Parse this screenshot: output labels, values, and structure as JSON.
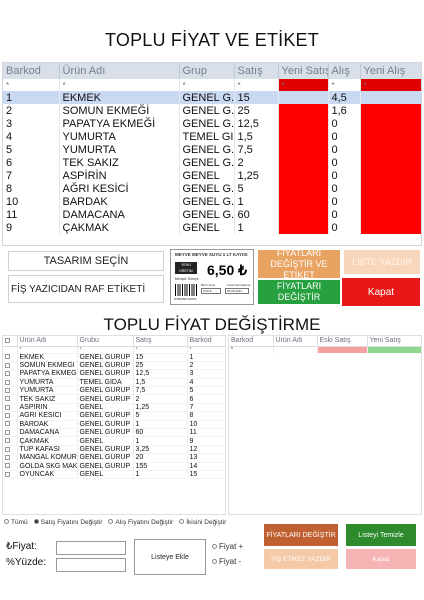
{
  "panel1": {
    "title": "TOPLU FİYAT VE ETİKET",
    "columns": [
      "Barkod",
      "Ürün Adı",
      "Grup",
      "Satış",
      "Yeni Satış",
      "Alış",
      "Yeni Alış"
    ],
    "star": "*",
    "rows": [
      {
        "barkod": "1",
        "urun": "EKMEK",
        "grup": "GENEL G...",
        "satis": "15",
        "alis": "4,5"
      },
      {
        "barkod": "2",
        "urun": "SOMUN EKMEĞİ",
        "grup": "GENEL G...",
        "satis": "25",
        "alis": "1,6"
      },
      {
        "barkod": "3",
        "urun": "PAPATYA EKMEĞİ",
        "grup": "GENEL G...",
        "satis": "12,5",
        "alis": "0"
      },
      {
        "barkod": "4",
        "urun": "YUMURTA",
        "grup": "TEMEL GI...",
        "satis": "1,5",
        "alis": "0"
      },
      {
        "barkod": "5",
        "urun": "YUMURTA",
        "grup": "GENEL G...",
        "satis": "7,5",
        "alis": "0"
      },
      {
        "barkod": "6",
        "urun": "TEK SAKIZ",
        "grup": "GENEL G...",
        "satis": "2",
        "alis": "0"
      },
      {
        "barkod": "7",
        "urun": "ASPİRİN",
        "grup": "GENEL",
        "satis": "1,25",
        "alis": "0"
      },
      {
        "barkod": "8",
        "urun": "AĞRI KESİCİ",
        "grup": "GENEL G...",
        "satis": "5",
        "alis": "0"
      },
      {
        "barkod": "10",
        "urun": "BARDAK",
        "grup": "GENEL G...",
        "satis": "1",
        "alis": "0"
      },
      {
        "barkod": "11",
        "urun": "DAMACANA",
        "grup": "GENEL G...",
        "satis": "60",
        "alis": "0"
      },
      {
        "barkod": "9",
        "urun": "ÇAKMAK",
        "grup": "GENEL",
        "satis": "1",
        "alis": "0"
      }
    ],
    "design_select": "TASARIM SEÇİN",
    "receipt_label": "FİŞ YAZICIDAN RAF ETİKETİ",
    "label_preview": {
      "title": "MEYVE MEYVE SUYU 1 LT KAYISI",
      "logo": "YERLİ ÜRETİM",
      "price": "6,50 ₺",
      "origin": "Menşei:Türkiye",
      "barcode": "8*999999*23655",
      "unit_caption": "Birim Fiyat",
      "unit_value": "6,50 ₺",
      "date_caption": "Fiyat Güncelleme",
      "date_value": "26.08.2021"
    },
    "buttons": {
      "change_label": "FİYATLARI DEĞİŞTİR VE ETİKET",
      "list_print": "LİSTE YAZDIR",
      "change_price": "FİYATLARI DEĞİŞTİR",
      "close": "Kapat"
    },
    "colors": {
      "accent_red": "#ff0000",
      "orange": "#e8a262",
      "green": "#27a040"
    }
  },
  "panel2": {
    "title": "TOPLU FİYAT DEĞİŞTİRME",
    "left_columns": [
      "",
      "Ürün Adı",
      "Grubu",
      "Satış",
      "Barkod"
    ],
    "star": "*",
    "left_rows": [
      {
        "urun": "EKMEK",
        "grup": "GENEL GURUP",
        "satis": "15",
        "barkod": "1"
      },
      {
        "urun": "SOMUN EKMEĞİ",
        "grup": "GENEL GURUP",
        "satis": "25",
        "barkod": "2"
      },
      {
        "urun": "PAPATYA EKMEĞİ",
        "grup": "GENEL GURUP",
        "satis": "12,5",
        "barkod": "3"
      },
      {
        "urun": "YUMURTA",
        "grup": "TEMEL GIDA",
        "satis": "1,5",
        "barkod": "4"
      },
      {
        "urun": "YUMURTA",
        "grup": "GENEL GURUP",
        "satis": "7,5",
        "barkod": "5"
      },
      {
        "urun": "TEK SAKIZ",
        "grup": "GENEL GURUP",
        "satis": "2",
        "barkod": "6"
      },
      {
        "urun": "ASPİRİN",
        "grup": "GENEL",
        "satis": "1,25",
        "barkod": "7"
      },
      {
        "urun": "AĞRI KESİCİ",
        "grup": "GENEL GURUP",
        "satis": "5",
        "barkod": "8"
      },
      {
        "urun": "BARDAK",
        "grup": "GENEL GURUP",
        "satis": "1",
        "barkod": "10"
      },
      {
        "urun": "DAMACANA",
        "grup": "GENEL GURUP",
        "satis": "60",
        "barkod": "11"
      },
      {
        "urun": "ÇAKMAK",
        "grup": "GENEL",
        "satis": "1",
        "barkod": "9"
      },
      {
        "urun": "TÜP KAFASI",
        "grup": "GENEL GURUP",
        "satis": "3,25",
        "barkod": "12"
      },
      {
        "urun": "MANGAL KÖMÜRÜ",
        "grup": "GENEL GURUP",
        "satis": "20",
        "barkod": "13"
      },
      {
        "urun": "GOLDA SKG MAK...",
        "grup": "GENEL GURUP",
        "satis": "155",
        "barkod": "14"
      },
      {
        "urun": "OYUNCAK",
        "grup": "GENEL",
        "satis": "1",
        "barkod": "15"
      }
    ],
    "right_columns": [
      "Barkod",
      "Ürün Adı",
      "Eski Satış",
      "Yeni Satış"
    ],
    "radio_options": [
      {
        "label": "Tümü",
        "selected": false
      },
      {
        "label": "Satış Fiyatını Değiştir",
        "selected": true
      },
      {
        "label": "Alış Fiyatını Değiştir",
        "selected": false
      },
      {
        "label": "İkisini Değiştir",
        "selected": false
      }
    ],
    "price_label": "₺Fiyat:",
    "percent_label": "%Yüzde:",
    "add_list": "Listeye Ekle",
    "plus_label": "Fiyat +",
    "minus_label": "Fiyat -",
    "buttons": {
      "change_price": "FİYATLARI DEĞİŞTİR",
      "clear_list": "Listeyi Temizle",
      "print_label": "FİŞ ETİKET YAZDIR",
      "close": "Kapat"
    }
  }
}
